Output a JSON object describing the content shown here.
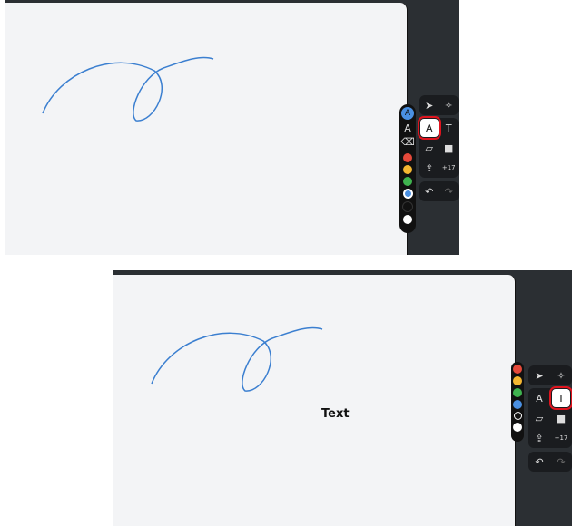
{
  "colors": {
    "accent": "#3b82f6",
    "red": "#e5493a",
    "yellow": "#f5b731",
    "green": "#3fb34f",
    "blue": "#4a90e2",
    "selection": "#e0141e"
  },
  "toolbar": {
    "select": "select-arrow-icon",
    "laser": "laser-icon",
    "draw": "pencil-icon",
    "text_tool": "T",
    "note": "note-icon",
    "shape": "rectangle-icon",
    "upload": "upload-icon",
    "more": "+17",
    "undo": "undo-icon",
    "redo": "redo-icon"
  },
  "canvas2": {
    "text_label": "Text"
  }
}
